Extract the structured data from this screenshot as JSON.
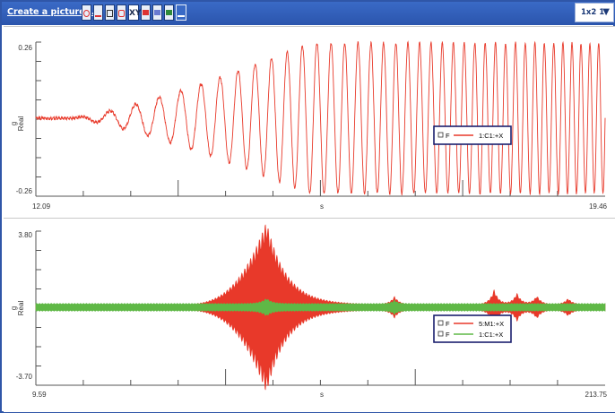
{
  "toolbar": {
    "create_picture_label": "Create a picture...",
    "xy_label": "XY",
    "layout_label": "1x2 1",
    "icons": [
      "fit-icon",
      "chart-icon",
      "table-icon",
      "zoom-icon",
      "xy-icon",
      "image-icon",
      "edit-icon",
      "document-icon",
      "export-icon"
    ]
  },
  "colors": {
    "toolbar_bg": "#2b55ad",
    "red": "#e8392a",
    "green": "#5fb846",
    "legend_border": "#1a1f6e"
  },
  "chart_data": [
    {
      "type": "line",
      "ylabel_top": "g",
      "ylabel_bottom": "Real",
      "yticks": [
        "0.26",
        "-0.26"
      ],
      "ylim": [
        -0.26,
        0.26
      ],
      "xlim": [
        12.09,
        19.46
      ],
      "x_start_label": "12.09",
      "x_end_label": "19.46",
      "x_unit": "s",
      "legend": [
        {
          "check": "F",
          "name": "1:C1:+X",
          "color": "#e8392a"
        }
      ],
      "series": [
        {
          "name": "1:C1:+X",
          "description_shape": "chirp rising amplitude to saturation"
        }
      ]
    },
    {
      "type": "line",
      "ylabel_top": "g",
      "ylabel_bottom": "Real",
      "yticks": [
        "3.80",
        "-3.70"
      ],
      "ylim": [
        -3.7,
        3.8
      ],
      "xlim": [
        9.59,
        213.75
      ],
      "x_start_label": "9.59",
      "x_end_label": "213.75",
      "x_unit": "s",
      "legend": [
        {
          "check": "F",
          "name": "5:M1:+X",
          "color": "#e8392a"
        },
        {
          "check": "F",
          "name": "1:C1:+X",
          "color": "#5fb846"
        }
      ]
    }
  ]
}
